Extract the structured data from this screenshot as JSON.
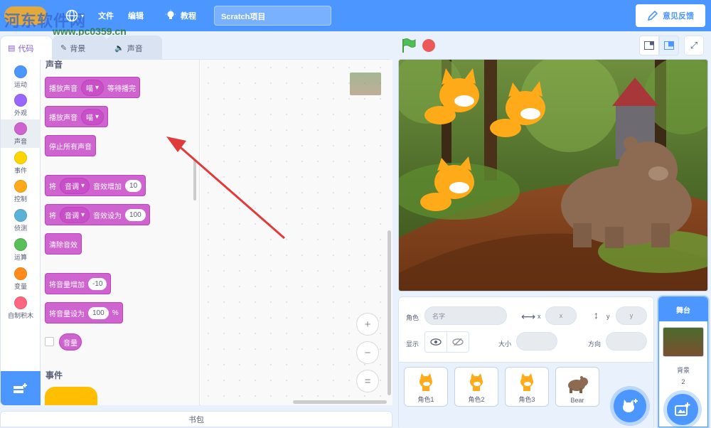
{
  "menubar": {
    "watermark": "河东软件网",
    "watermark_url": "www.pc0359.cn",
    "file": "文件",
    "edit": "编辑",
    "tutorials": "教程",
    "project_title": "Scratch项目",
    "feedback": "意见反馈"
  },
  "tabs": {
    "code": "代码",
    "backdrop": "背景",
    "sounds": "声音"
  },
  "categories": [
    {
      "label": "运动",
      "color": "#4c97ff"
    },
    {
      "label": "外观",
      "color": "#9966ff"
    },
    {
      "label": "声音",
      "color": "#cf63cf"
    },
    {
      "label": "事件",
      "color": "#ffd500"
    },
    {
      "label": "控制",
      "color": "#ffab19"
    },
    {
      "label": "侦测",
      "color": "#5cb1d6"
    },
    {
      "label": "运算",
      "color": "#59c059"
    },
    {
      "label": "变量",
      "color": "#ff8c1a"
    },
    {
      "label": "自制积木",
      "color": "#ff6680"
    }
  ],
  "palette": {
    "section_sound": "声音",
    "play_until_done": {
      "a": "播放声音",
      "drop": "喵",
      "b": "等待播完"
    },
    "start_sound": {
      "a": "播放声音",
      "drop": "喵"
    },
    "stop_all": "停止所有声音",
    "change_effect": {
      "a": "将",
      "drop": "音调",
      "b": "音效增加",
      "val": "10"
    },
    "set_effect": {
      "a": "将",
      "drop": "音调",
      "b": "音效设为",
      "val": "100"
    },
    "clear_effects": "清除音效",
    "change_volume": {
      "a": "将音量增加",
      "val": "-10"
    },
    "set_volume": {
      "a": "将音量设为",
      "val": "100",
      "unit": "%"
    },
    "volume": "音量",
    "section_events": "事件"
  },
  "zoom": {
    "in": "+",
    "out": "−",
    "reset": "="
  },
  "backpack": "书包",
  "sprite_info": {
    "sprite_label": "角色",
    "name_placeholder": "名字",
    "x_label": "x",
    "x_placeholder": "x",
    "y_label": "y",
    "y_placeholder": "y",
    "show_label": "显示",
    "size_label": "大小",
    "direction_label": "方向"
  },
  "sprites": [
    {
      "name": "角色1",
      "icon": "cat-sprite-icon"
    },
    {
      "name": "角色2",
      "icon": "cat-sprite-icon"
    },
    {
      "name": "角色3",
      "icon": "cat-sprite-icon"
    },
    {
      "name": "Bear",
      "icon": "bear-sprite-icon"
    }
  ],
  "stage_selector": {
    "title": "舞台",
    "backdrops_label": "背景",
    "backdrops_count": "2"
  },
  "colors": {
    "accent": "#4c97ff",
    "sound_block": "#cf63cf",
    "stop": "#ec5959",
    "green_flag": "#4cbf56"
  }
}
